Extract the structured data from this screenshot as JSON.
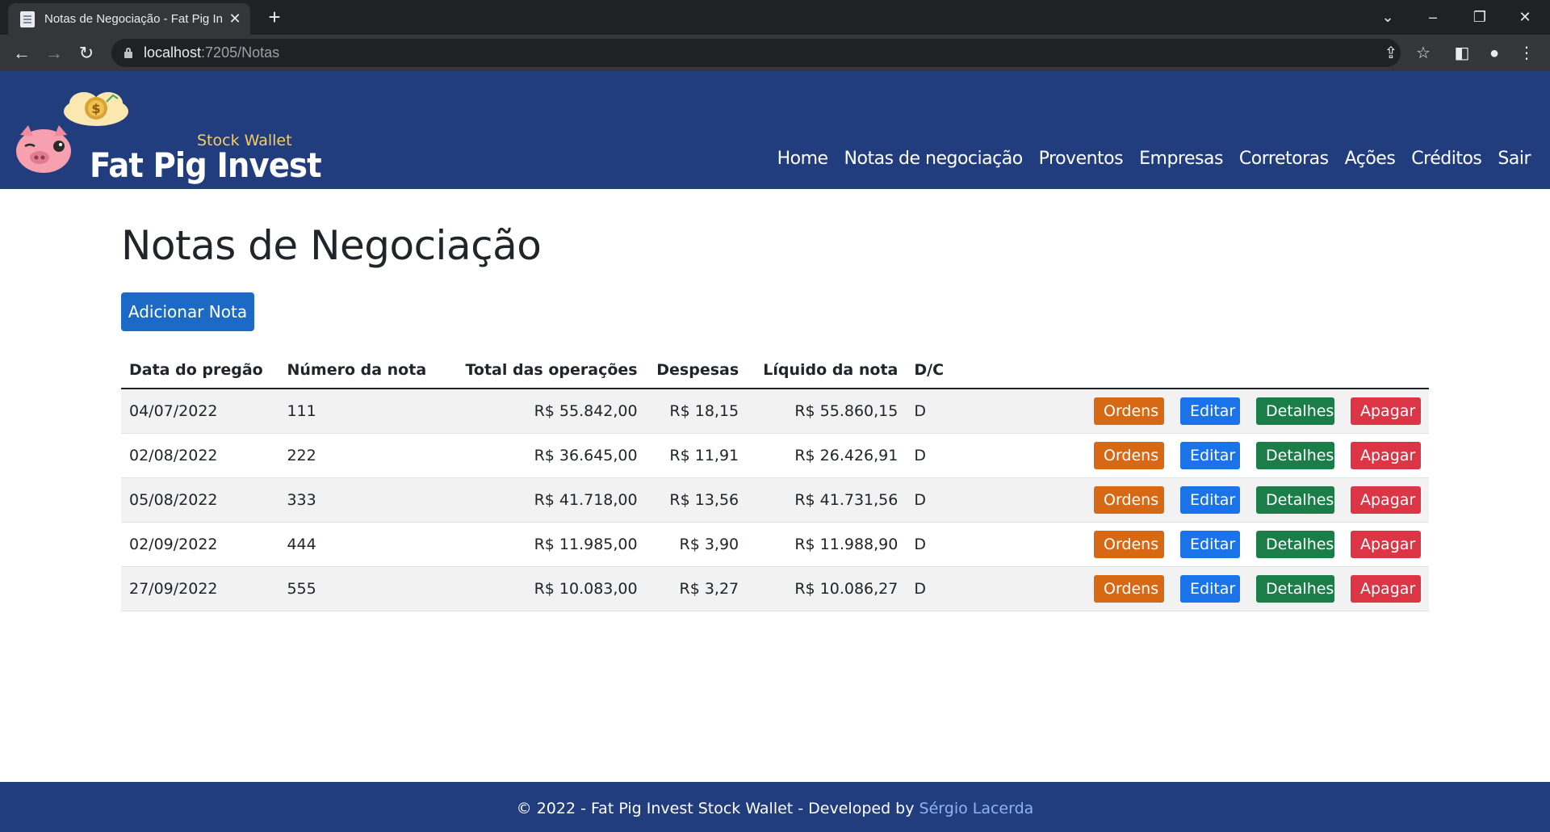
{
  "browser": {
    "tab_title": "Notas de Negociação - Fat Pig Invest",
    "url_host": "localhost",
    "url_path": ":7205/Notas"
  },
  "brand": {
    "subtitle": "Stock Wallet",
    "name": "Fat Pig Invest"
  },
  "nav": {
    "items": [
      {
        "label": "Home"
      },
      {
        "label": "Notas de negociação"
      },
      {
        "label": "Proventos"
      },
      {
        "label": "Empresas"
      },
      {
        "label": "Corretoras"
      },
      {
        "label": "Ações"
      },
      {
        "label": "Créditos"
      },
      {
        "label": "Sair"
      }
    ]
  },
  "main": {
    "title": "Notas de Negociação",
    "add_button": "Adicionar Nota",
    "table": {
      "headers": [
        "Data do pregão",
        "Número da nota",
        "Total das operações",
        "Despesas",
        "Líquido da nota",
        "D/C"
      ],
      "rows": [
        {
          "data": "04/07/2022",
          "numero": "111",
          "total": "R$ 55.842,00",
          "despesas": "R$ 18,15",
          "liquido": "R$ 55.860,15",
          "dc": "D"
        },
        {
          "data": "02/08/2022",
          "numero": "222",
          "total": "R$ 36.645,00",
          "despesas": "R$ 11,91",
          "liquido": "R$ 26.426,91",
          "dc": "D"
        },
        {
          "data": "05/08/2022",
          "numero": "333",
          "total": "R$ 41.718,00",
          "despesas": "R$ 13,56",
          "liquido": "R$ 41.731,56",
          "dc": "D"
        },
        {
          "data": "02/09/2022",
          "numero": "444",
          "total": "R$ 11.985,00",
          "despesas": "R$ 3,90",
          "liquido": "R$ 11.988,90",
          "dc": "D"
        },
        {
          "data": "27/09/2022",
          "numero": "555",
          "total": "R$ 10.083,00",
          "despesas": "R$ 3,27",
          "liquido": "R$ 10.086,27",
          "dc": "D"
        }
      ],
      "actions": {
        "ordens": "Ordens",
        "editar": "Editar",
        "detalhes": "Detalhes",
        "apagar": "Apagar"
      }
    }
  },
  "footer": {
    "text": "© 2022 - Fat Pig Invest Stock Wallet - Developed by ",
    "author": "Sérgio Lacerda"
  },
  "colors": {
    "navbar": "#213d7d",
    "primary": "#1d6ac6",
    "ordens": "#d76915",
    "editar": "#1a73e8",
    "detalhes": "#1b7d48",
    "apagar": "#dc3545"
  }
}
